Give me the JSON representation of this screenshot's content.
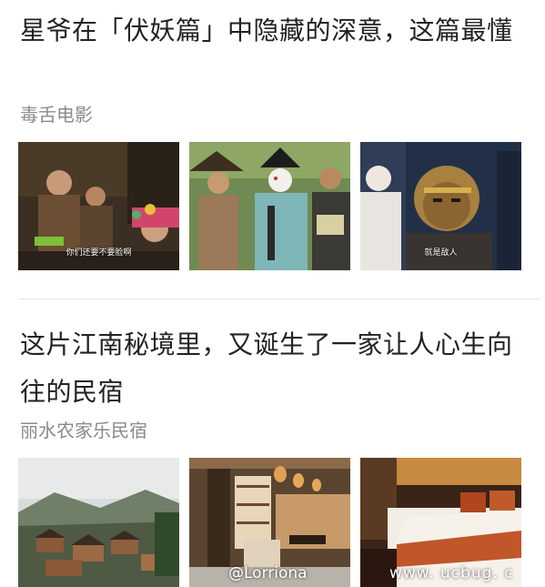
{
  "articles": [
    {
      "title": "星爷在「伏妖篇」中隐藏的深意，这篇最懂",
      "source": "毒舌电影",
      "thumbs": [
        {
          "caption": "你们还要不要脸啊"
        },
        {
          "caption": ""
        },
        {
          "caption": "就是敌人"
        }
      ]
    },
    {
      "title": "这片江南秘境里，又诞生了一家让人心生向往的民宿",
      "source": "丽水农家乐民宿",
      "thumbs": [
        {
          "caption": ""
        },
        {
          "caption": ""
        },
        {
          "caption": ""
        }
      ]
    }
  ],
  "watermarks": {
    "left": "@Lorriona",
    "right": "www. ucbug. c"
  }
}
